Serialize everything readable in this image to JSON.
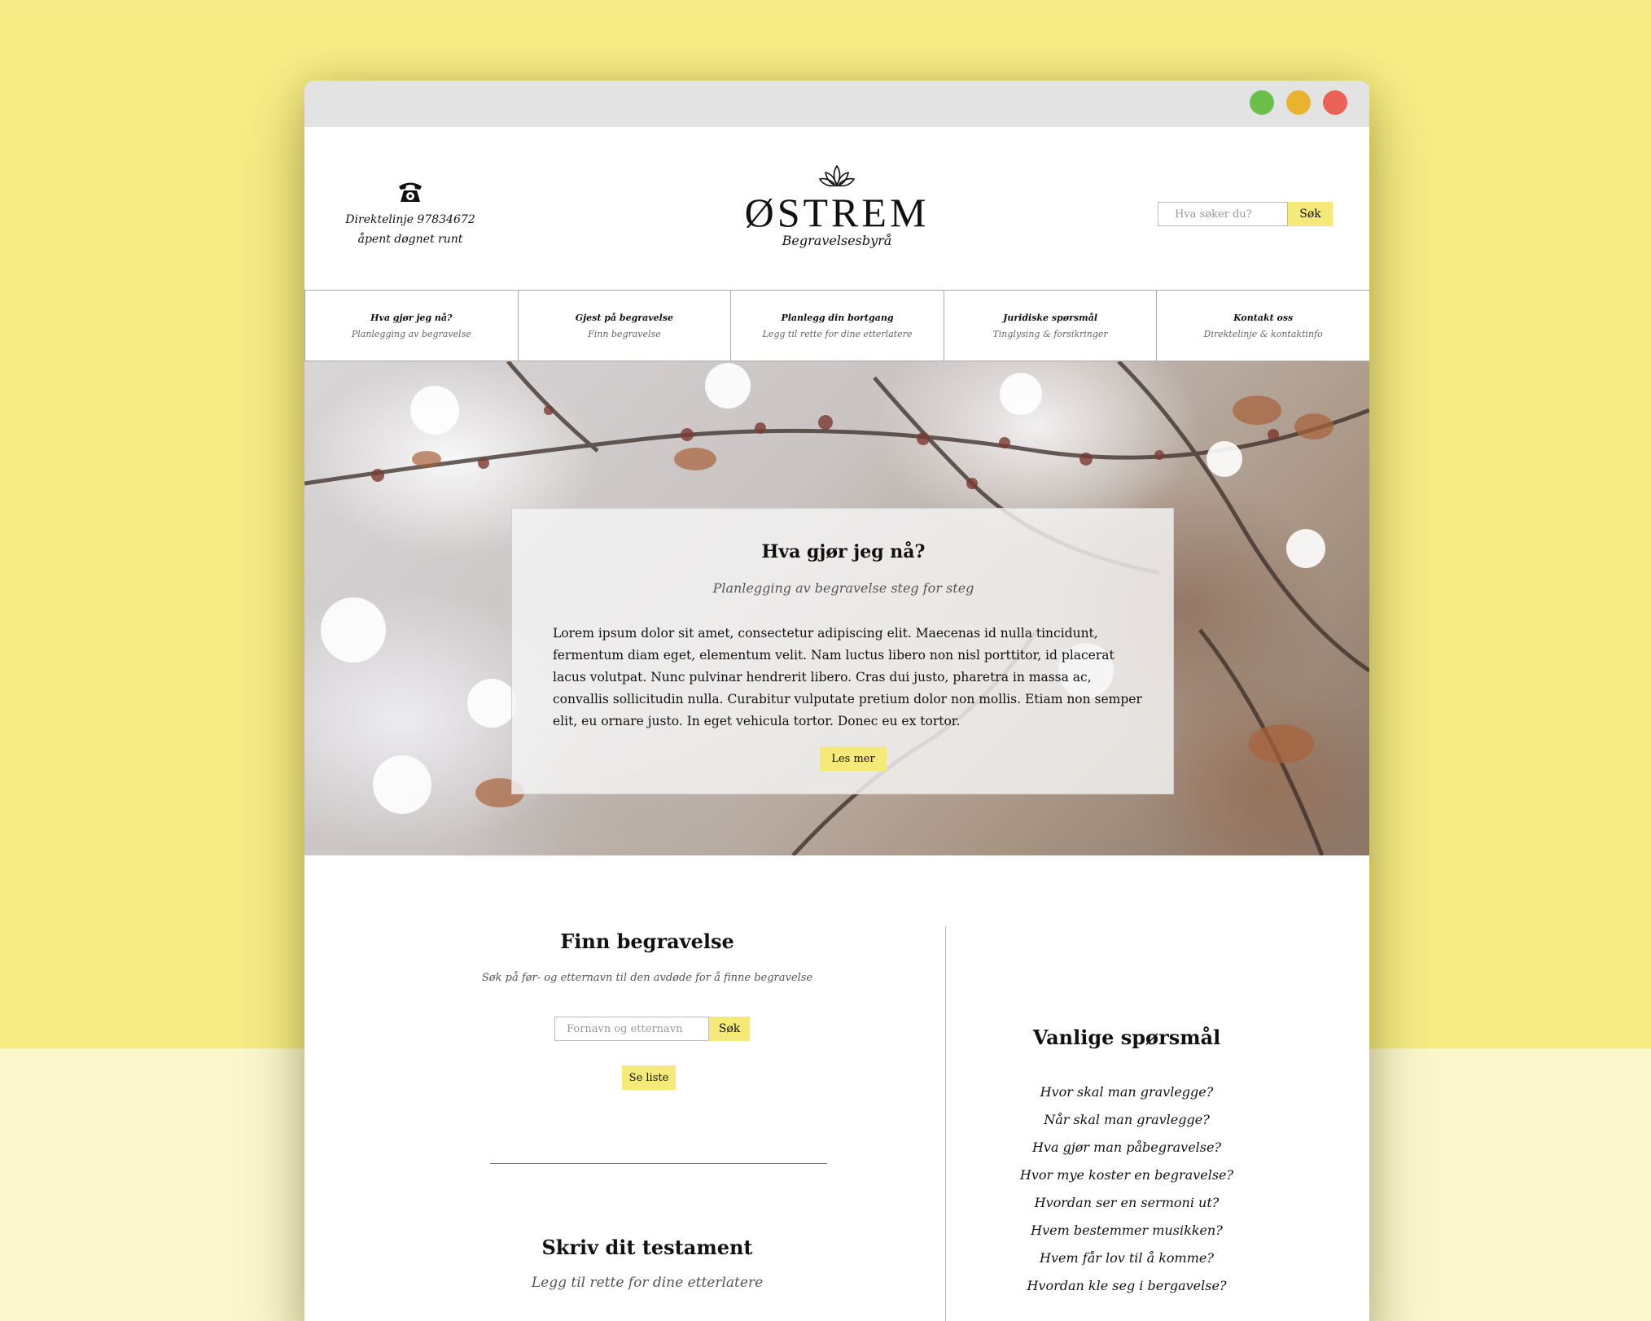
{
  "window": {
    "controls": [
      {
        "name": "maximize",
        "color": "#6cbf4b"
      },
      {
        "name": "minimize",
        "color": "#e9b230"
      },
      {
        "name": "close",
        "color": "#eb6356"
      }
    ]
  },
  "header": {
    "hotline_line1": "Direktelinje 97834672",
    "hotline_line2": "åpent døgnet runt",
    "phone_icon": "telephone-icon",
    "logo_icon": "lotus-icon",
    "logo_name": "ØSTREM",
    "logo_sub": "Begravelsesbyrå",
    "search_placeholder": "Hva søker du?",
    "search_button": "Søk"
  },
  "nav": {
    "items": [
      {
        "title": "Hva gjør jeg nå?",
        "sub": "Planlegging av begravelse"
      },
      {
        "title": "Gjest på begravelse",
        "sub": "Finn begravelse"
      },
      {
        "title": "Planlegg din bortgang",
        "sub": "Legg til rette for dine etterlatere"
      },
      {
        "title": "Juridiske spørsmål",
        "sub": "Tinglysing & forsikringer"
      },
      {
        "title": "Kontakt oss",
        "sub": "Direktelinje & kontaktinfo"
      }
    ]
  },
  "hero": {
    "title": "Hva gjør jeg nå?",
    "subtitle": "Planlegging av begravelse steg for steg",
    "body": "Lorem ipsum dolor sit amet, consectetur adipiscing elit. Maecenas id nulla tincidunt, fermentum diam eget, elementum velit. Nam luctus libero non nisl porttitor, id placerat lacus volutpat. Nunc pulvinar hendrerit libero. Cras dui justo, pharetra in massa ac, convallis sollicitudin nulla. Curabitur vulputate pretium dolor non mollis. Etiam non semper elit, eu ornare justo. In eget vehicula tortor. Donec eu ex tortor.",
    "button": "Les mer"
  },
  "finn": {
    "title": "Finn begravelse",
    "subtitle": "Søk på før- og etternavn til den avdøde for å finne begravelse",
    "input_placeholder": "Fornavn og etternavn",
    "search_button": "Søk",
    "list_button": "Se liste"
  },
  "testament": {
    "title": "Skriv dit testament",
    "subtitle": "Legg til rette for dine etterlatere"
  },
  "faq": {
    "title": "Vanlige spørsmål",
    "items": [
      "Hvor skal man gravlegge?",
      "Når skal man gravlegge?",
      "Hva gjør man påbegravelse?",
      "Hvor mye koster en begravelse?",
      "Hvordan ser en sermoni ut?",
      "Hvem bestemmer musikken?",
      "Hvem får lov til å komme?",
      "Hvordan kle seg i bergavelse?"
    ]
  },
  "colors": {
    "background": "#f7ec85",
    "background_lower": "#fcf7cd",
    "accent": "#f5e97a"
  }
}
